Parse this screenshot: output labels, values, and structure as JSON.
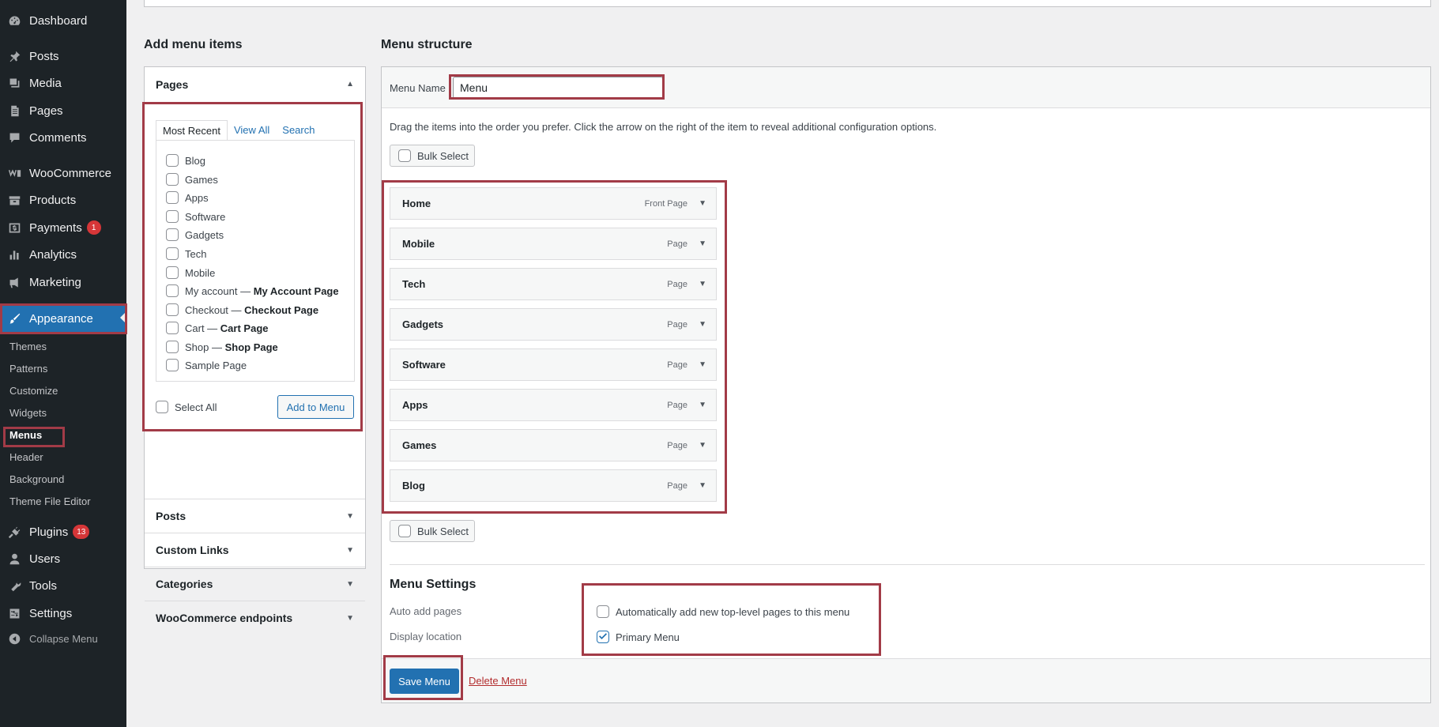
{
  "sidebar": {
    "items": [
      {
        "label": "Dashboard",
        "icon": "dashboard-icon"
      },
      {
        "label": "Posts",
        "icon": "pin-icon"
      },
      {
        "label": "Media",
        "icon": "media-icon"
      },
      {
        "label": "Pages",
        "icon": "pages-icon"
      },
      {
        "label": "Comments",
        "icon": "comment-icon"
      },
      {
        "label": "WooCommerce",
        "icon": "woocommerce-icon"
      },
      {
        "label": "Products",
        "icon": "archive-icon"
      },
      {
        "label": "Payments",
        "icon": "dollar-icon",
        "badge": "1"
      },
      {
        "label": "Analytics",
        "icon": "bar-chart-icon"
      },
      {
        "label": "Marketing",
        "icon": "megaphone-icon"
      },
      {
        "label": "Appearance",
        "icon": "brush-icon"
      },
      {
        "label": "Plugins",
        "icon": "plug-icon",
        "badge": "13"
      },
      {
        "label": "Users",
        "icon": "user-icon"
      },
      {
        "label": "Tools",
        "icon": "wrench-icon"
      },
      {
        "label": "Settings",
        "icon": "settings-icon"
      },
      {
        "label": "Collapse Menu",
        "icon": "collapse-icon"
      }
    ],
    "appearance_submenu": [
      "Themes",
      "Patterns",
      "Customize",
      "Widgets",
      "Menus",
      "Header",
      "Background",
      "Theme File Editor"
    ]
  },
  "add_items": {
    "title": "Add menu items",
    "sections": [
      "Pages",
      "Posts",
      "Custom Links",
      "Categories",
      "WooCommerce endpoints"
    ],
    "tabs": [
      "Most Recent",
      "View All",
      "Search"
    ],
    "pages": [
      {
        "label": "Blog",
        "suffix": ""
      },
      {
        "label": "Games",
        "suffix": ""
      },
      {
        "label": "Apps",
        "suffix": ""
      },
      {
        "label": "Software",
        "suffix": ""
      },
      {
        "label": "Gadgets",
        "suffix": ""
      },
      {
        "label": "Tech",
        "suffix": ""
      },
      {
        "label": "Mobile",
        "suffix": ""
      },
      {
        "label": "My account — ",
        "suffix": "My Account Page"
      },
      {
        "label": "Checkout — ",
        "suffix": "Checkout Page"
      },
      {
        "label": "Cart — ",
        "suffix": "Cart Page"
      },
      {
        "label": "Shop — ",
        "suffix": "Shop Page"
      },
      {
        "label": "Sample Page",
        "suffix": ""
      }
    ],
    "select_all_label": "Select All",
    "add_button": "Add to Menu"
  },
  "structure": {
    "title": "Menu structure",
    "menu_name_label": "Menu Name",
    "menu_name_value": "Menu",
    "instructions": "Drag the items into the order you prefer. Click the arrow on the right of the item to reveal additional configuration options.",
    "bulk_select": "Bulk Select",
    "items": [
      {
        "label": "Home",
        "type": "Front Page"
      },
      {
        "label": "Mobile",
        "type": "Page"
      },
      {
        "label": "Tech",
        "type": "Page"
      },
      {
        "label": "Gadgets",
        "type": "Page"
      },
      {
        "label": "Software",
        "type": "Page"
      },
      {
        "label": "Apps",
        "type": "Page"
      },
      {
        "label": "Games",
        "type": "Page"
      },
      {
        "label": "Blog",
        "type": "Page"
      }
    ]
  },
  "settings": {
    "title": "Menu Settings",
    "auto_add_label": "Auto add pages",
    "auto_add_option": "Automatically add new top-level pages to this menu",
    "auto_add_checked": false,
    "display_location_label": "Display location",
    "primary_menu_option": "Primary Menu",
    "primary_menu_checked": true
  },
  "footer": {
    "save": "Save Menu",
    "delete": "Delete Menu"
  },
  "colors": {
    "accent": "#2271b1",
    "sidebar_bg": "#1d2327",
    "highlight_border": "#a23b47",
    "badge": "#d63638"
  }
}
